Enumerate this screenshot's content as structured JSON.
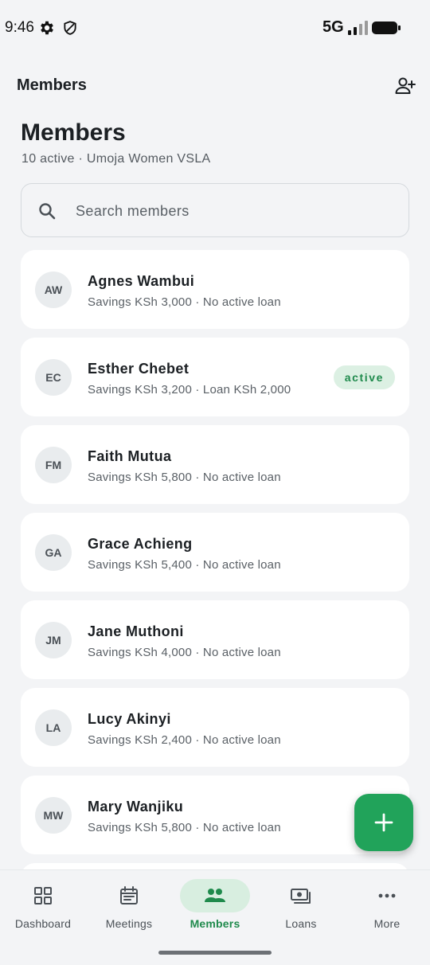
{
  "status_bar": {
    "time": "9:46",
    "network": "5G",
    "icons": [
      "gear-icon",
      "shield-icon",
      "signal-icon",
      "battery-icon"
    ]
  },
  "app_bar": {
    "title": "Members",
    "action_icon": "add-person-icon"
  },
  "header": {
    "title": "Members",
    "subtitle": "10 active · Umoja Women VSLA"
  },
  "search": {
    "placeholder": "Search members",
    "value": ""
  },
  "members": [
    {
      "initials": "AW",
      "name": "Agnes Wambui",
      "meta": "Savings KSh 3,000 · No active loan",
      "badge": ""
    },
    {
      "initials": "EC",
      "name": "Esther Chebet",
      "meta": "Savings KSh 3,200 · Loan KSh 2,000",
      "badge": "active"
    },
    {
      "initials": "FM",
      "name": "Faith Mutua",
      "meta": "Savings KSh 5,800 · No active loan",
      "badge": ""
    },
    {
      "initials": "GA",
      "name": "Grace Achieng",
      "meta": "Savings KSh 5,400 · No active loan",
      "badge": ""
    },
    {
      "initials": "JM",
      "name": "Jane Muthoni",
      "meta": "Savings KSh 4,000 · No active loan",
      "badge": ""
    },
    {
      "initials": "LA",
      "name": "Lucy Akinyi",
      "meta": "Savings KSh 2,400 · No active loan",
      "badge": ""
    },
    {
      "initials": "MW",
      "name": "Mary Wanjiku",
      "meta": "Savings KSh 5,800 · No active loan",
      "badge": ""
    },
    {
      "initials": "",
      "name": "",
      "meta": "",
      "badge": ""
    }
  ],
  "fab": {
    "icon": "plus-icon"
  },
  "bottom_nav": {
    "active": "Members",
    "items": [
      {
        "label": "Dashboard",
        "icon": "grid-icon"
      },
      {
        "label": "Meetings",
        "icon": "calendar-icon"
      },
      {
        "label": "Members",
        "icon": "people-icon"
      },
      {
        "label": "Loans",
        "icon": "cash-icon"
      },
      {
        "label": "More",
        "icon": "more-dots-icon"
      }
    ]
  },
  "colors": {
    "accent": "#21a35a",
    "accent_text": "#1f8a4c",
    "accent_soft": "#d8eee0",
    "background": "#f3f4f6",
    "card": "#ffffff"
  }
}
